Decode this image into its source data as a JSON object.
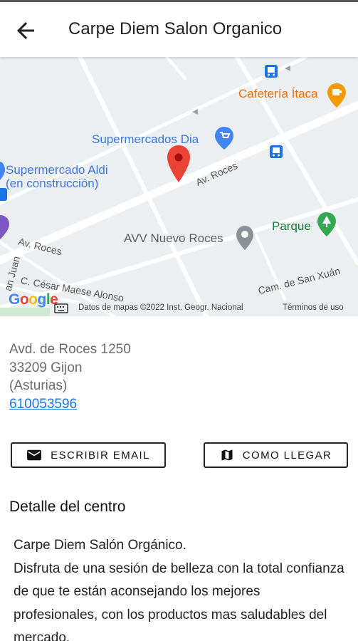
{
  "appbar": {
    "title": "Carpe Diem Salon Organico",
    "back_icon": "arrow-back-icon"
  },
  "map": {
    "places": {
      "cafeteria": "Cafetería Ítaca",
      "supermercados_dia": "Supermercados Dia",
      "aldi_line1": "Supermercado Aldi",
      "aldi_line2": "(en construcción)",
      "avv": "AVV Nuevo Roces",
      "parque": "Parque"
    },
    "roads": {
      "av_roces_1": "Av. Roces",
      "av_roces_2": "Av. Roces",
      "cesar": "C. César Maese Alonso",
      "san_xuan": "Cam. de San Xuán",
      "juan": "an Juan"
    },
    "google_logo": "Google",
    "footer": "Datos de mapas ©2022 Inst. Geogr. Nacional",
    "terms": "Términos de uso"
  },
  "address": {
    "street": "Avd. de Roces 1250",
    "postal_city": "33209 Gijon",
    "region": "(Asturias)",
    "phone": "610053596"
  },
  "actions": {
    "email_label": "ESCRIBIR EMAIL",
    "email_icon": "mail-icon",
    "directions_label": "COMO LLEGAR",
    "directions_icon": "map-icon"
  },
  "detail": {
    "title": "Detalle del centro",
    "line1": "Carpe Diem Salón Orgánico.",
    "line2": "Disfruta de una sesión de belleza con la total confianza de que te están aconsejando los mejores profesionales, con los productos mas saludables del mercado."
  },
  "colors": {
    "link": "#1a73e8",
    "pin": "#ea4335",
    "map_bg": "#eceff1"
  }
}
